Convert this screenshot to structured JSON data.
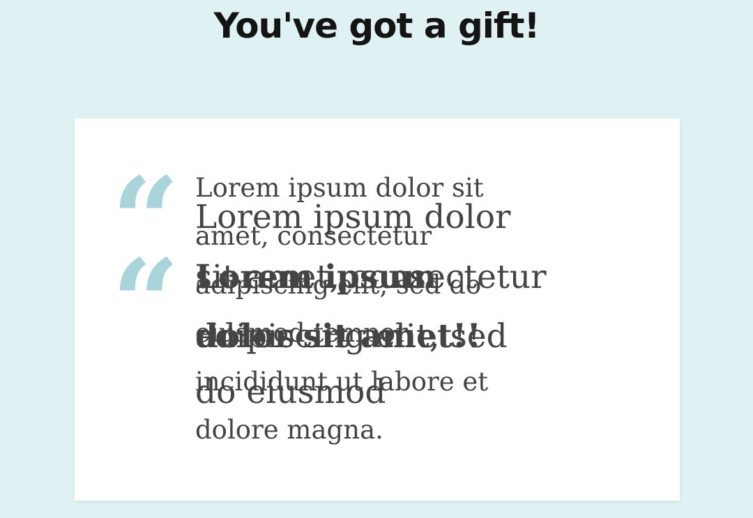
{
  "header": {
    "title": "You've got a gift!"
  },
  "card": {
    "quote_icon": "left-double-quote-icon",
    "quote_glyph": "“",
    "accent_color": "#a9d5da",
    "message_small": [
      "Lorem ipsum dolor sit",
      "amet, consectetur",
      "adipiscing elit, sed do",
      "eiusmod tempor",
      "incididunt ut labore et",
      "dolore magna."
    ],
    "message_large": [
      "Lorem ipsum dolor",
      "sit amet, consectetur",
      "adipiscing elit, sed",
      "do eiusmod"
    ],
    "message_bold": [
      "Lorem ipsum",
      "dolor sit amet!!"
    ]
  }
}
